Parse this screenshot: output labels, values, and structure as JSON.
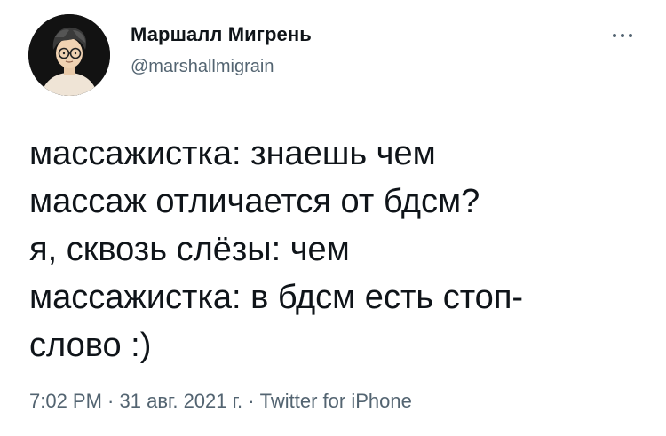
{
  "author": {
    "display_name": "Маршалл Мигрень",
    "handle": "@marshallmigrain"
  },
  "tweet": {
    "lines": [
      "массажистка: знаешь чем",
      "массаж отличается от бдсм?",
      "я, сквозь слёзы: чем",
      "массажистка: в бдсм есть стоп-",
      "слово :)"
    ]
  },
  "meta": {
    "time": "7:02 PM",
    "separator": " · ",
    "date": "31 авг. 2021 г.",
    "source": "Twitter for iPhone"
  },
  "icons": {
    "more": "more-horizontal-icon",
    "avatar": "avatar-illustration"
  },
  "colors": {
    "text": "#0f1419",
    "secondary": "#536471",
    "background": "#ffffff"
  }
}
